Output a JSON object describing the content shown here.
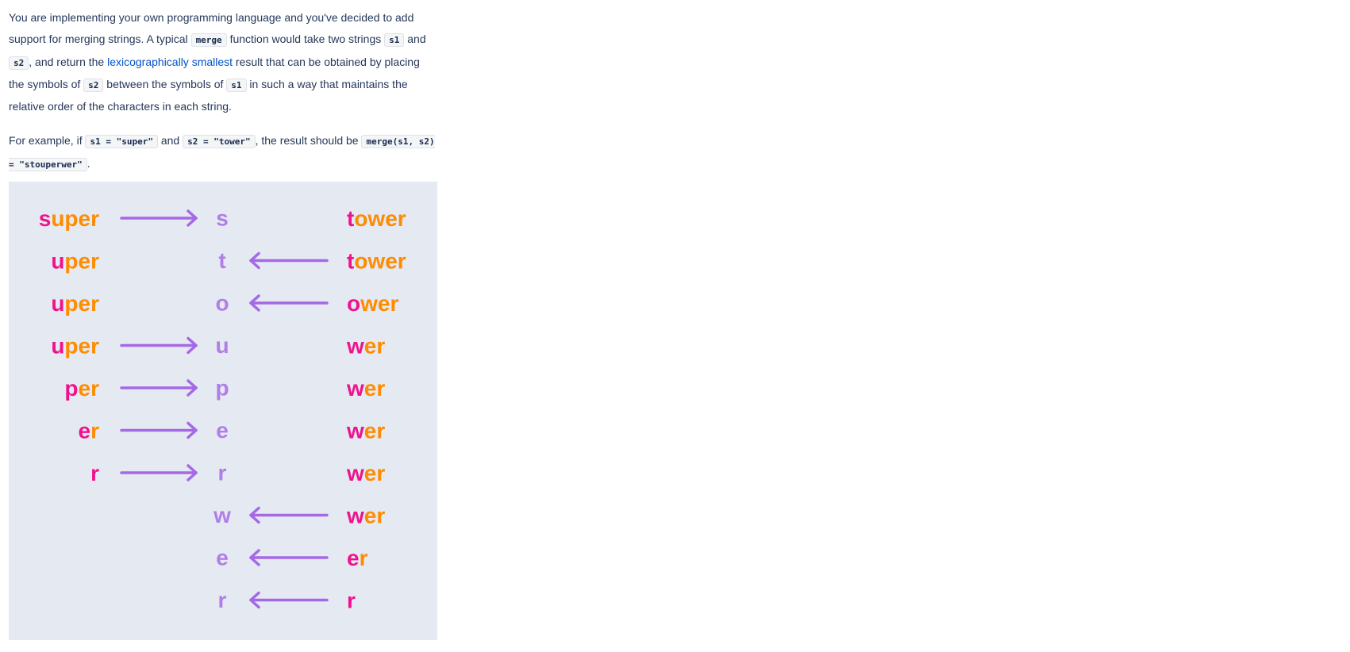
{
  "para1": {
    "t1": "You are implementing your own programming language and you've decided to add support for merging strings. A typical ",
    "code_merge": "merge",
    "t2": " function would take two strings ",
    "code_s1": "s1",
    "t3": " and ",
    "code_s2": "s2",
    "t4": ", and return the ",
    "link": "lexicographically smallest",
    "t5": " result that can be obtained by placing the symbols of ",
    "code_s2b": "s2",
    "t6": " between the symbols of ",
    "code_s1b": "s1",
    "t7": " in such a way that maintains the relative order of the characters in each string."
  },
  "para2": {
    "t1": "For example, if ",
    "code_a": "s1 = \"super\"",
    "t2": " and ",
    "code_b": "s2 = \"tower\"",
    "t3": ", the result should be ",
    "code_c": "merge(s1, s2) = \"stouperwer\"",
    "t4": "."
  },
  "colors": {
    "pink": "#f0128c",
    "orange": "#ff8c00",
    "purple": "#b07ee6",
    "arrow": "#a569e6",
    "panel": "#e4e9f2"
  },
  "diagram": {
    "steps": [
      {
        "left_first": "s",
        "left_rest": "uper",
        "arrow": "right",
        "out": "s",
        "right_first": "t",
        "right_rest": "ower"
      },
      {
        "left_first": "u",
        "left_rest": "per",
        "arrow": "left",
        "out": "t",
        "right_first": "t",
        "right_rest": "ower"
      },
      {
        "left_first": "u",
        "left_rest": "per",
        "arrow": "left",
        "out": "o",
        "right_first": "o",
        "right_rest": "wer"
      },
      {
        "left_first": "u",
        "left_rest": "per",
        "arrow": "right",
        "out": "u",
        "right_first": "w",
        "right_rest": "er"
      },
      {
        "left_first": "p",
        "left_rest": "er",
        "arrow": "right",
        "out": "p",
        "right_first": "w",
        "right_rest": "er"
      },
      {
        "left_first": "e",
        "left_rest": "r",
        "arrow": "right",
        "out": "e",
        "right_first": "w",
        "right_rest": "er"
      },
      {
        "left_first": "r",
        "left_rest": "",
        "arrow": "right",
        "out": "r",
        "right_first": "w",
        "right_rest": "er"
      },
      {
        "left_first": "",
        "left_rest": "",
        "arrow": "left",
        "out": "w",
        "right_first": "w",
        "right_rest": "er"
      },
      {
        "left_first": "",
        "left_rest": "",
        "arrow": "left",
        "out": "e",
        "right_first": "e",
        "right_rest": "r"
      },
      {
        "left_first": "",
        "left_rest": "",
        "arrow": "left",
        "out": "r",
        "right_first": "r",
        "right_rest": ""
      }
    ]
  }
}
